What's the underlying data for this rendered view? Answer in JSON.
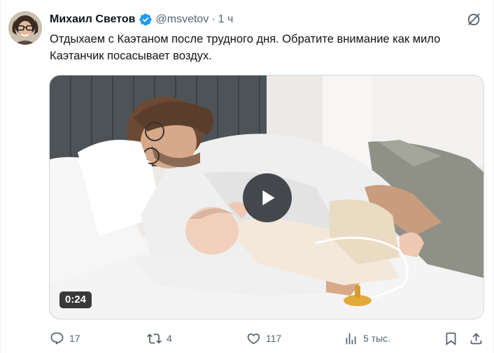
{
  "author": {
    "name": "Михаил Светов",
    "handle": "@msvetov",
    "separator": "·",
    "time": "1 ч"
  },
  "tweet": {
    "text": "Отдыхаем с Каэтаном после трудного дня. Обратите внимание как мило Каэтанчик посасывает воздух."
  },
  "media": {
    "type": "video",
    "duration": "0:24"
  },
  "actions": {
    "replies": "17",
    "retweets": "4",
    "likes": "117",
    "views": "5 тыс."
  },
  "icons": {
    "verified": "verified-badge-icon",
    "grok": "grok-icon",
    "reply": "reply-icon",
    "retweet": "retweet-icon",
    "like": "heart-icon",
    "views": "views-chart-icon",
    "bookmark": "bookmark-icon",
    "share": "share-icon",
    "play": "play-icon"
  },
  "colors": {
    "text_primary": "#0f1419",
    "text_secondary": "#536471",
    "verified": "#1d9bf0",
    "border": "#cfd9de"
  }
}
